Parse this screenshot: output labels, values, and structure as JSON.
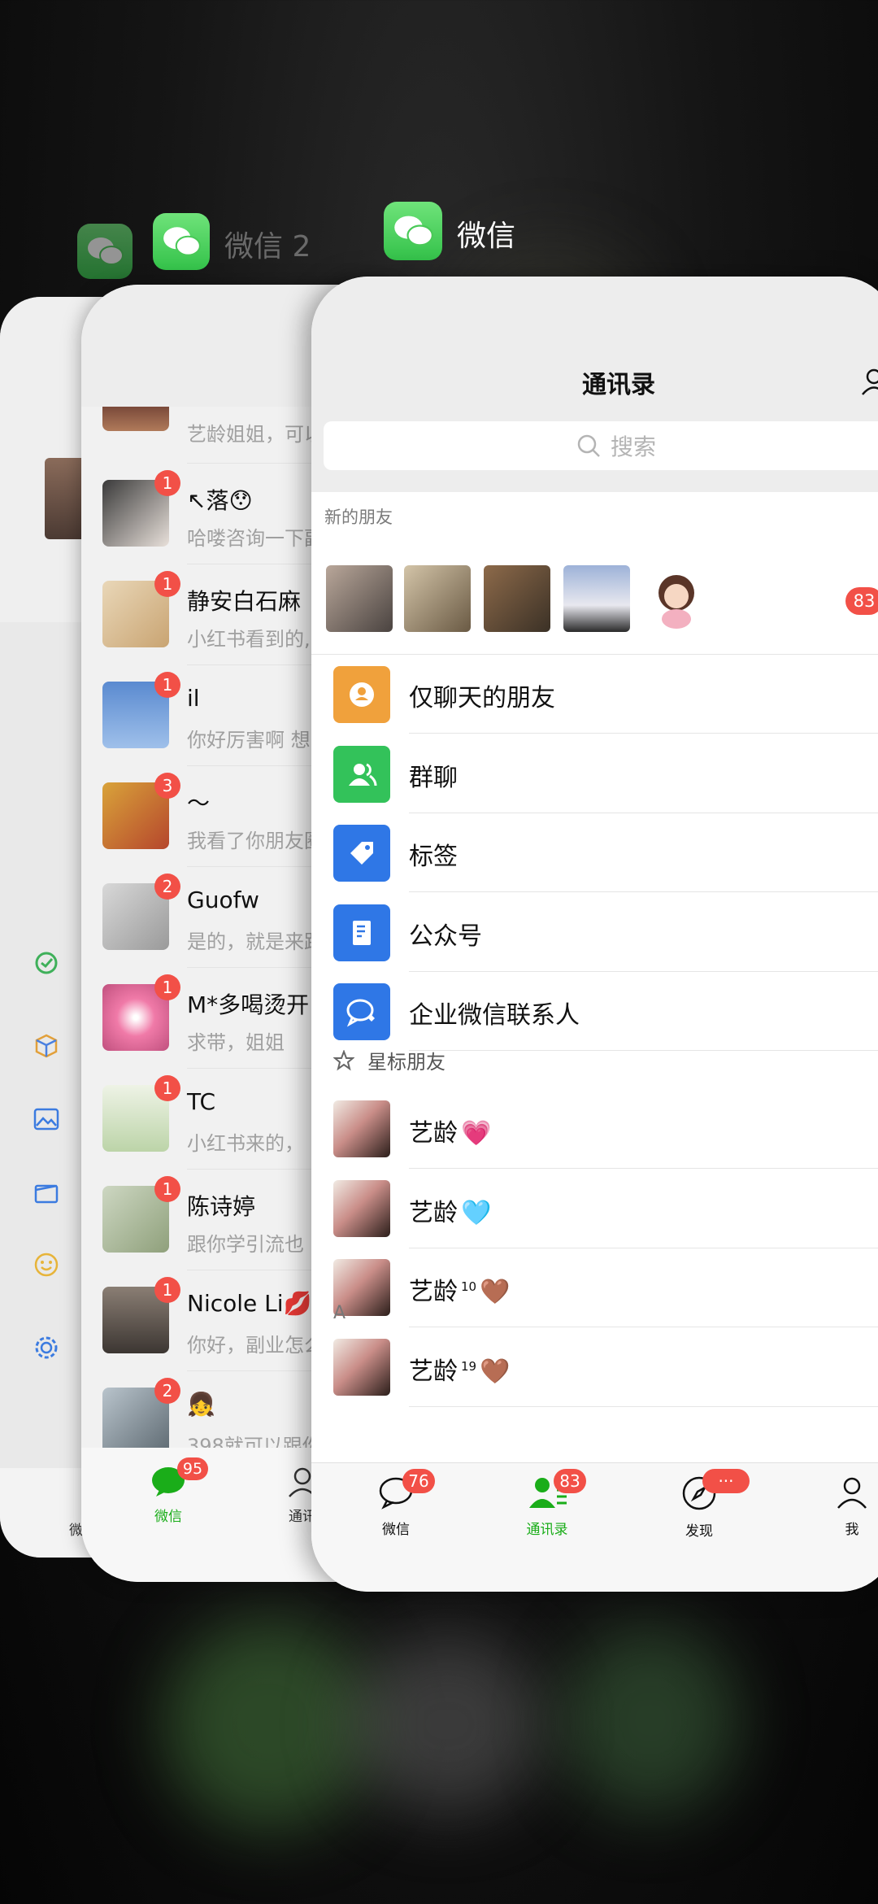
{
  "switcher": {
    "app_current": "微信",
    "app_second": "微信 2"
  },
  "front": {
    "title": "通讯录",
    "search_placeholder": "搜索",
    "new_friends_label": "新的朋友",
    "new_friends_count": "83",
    "menu": [
      {
        "label": "仅聊天的朋友",
        "color": "#f0a13c"
      },
      {
        "label": "群聊",
        "color": "#33c25a"
      },
      {
        "label": "标签",
        "color": "#2f77e6"
      },
      {
        "label": "公众号",
        "color": "#2f77e6"
      },
      {
        "label": "企业微信联系人",
        "color": "#2f77e6"
      }
    ],
    "starred_label": "星标朋友",
    "starred": [
      {
        "name": "艺龄",
        "emoji": "💗",
        "sup": ""
      },
      {
        "name": "艺龄",
        "emoji": "🩵",
        "sup": ""
      },
      {
        "name": "艺龄",
        "emoji": "🤎",
        "sup": "10"
      },
      {
        "name": "艺龄",
        "emoji": "🤎",
        "sup": "19"
      }
    ],
    "alpha": "A",
    "tabs": [
      {
        "label": "微信",
        "badge": "76"
      },
      {
        "label": "通讯录",
        "badge": "83"
      },
      {
        "label": "发现",
        "badge": "···"
      },
      {
        "label": "我",
        "badge": ""
      }
    ]
  },
  "mid": {
    "top_partial": "艺龄姐姐，可以",
    "chats": [
      {
        "name": "↖落😯",
        "msg": "哈喽咨询一下副",
        "badge": "1"
      },
      {
        "name": "静安白石麻",
        "msg": "小红书看到的,",
        "badge": "1"
      },
      {
        "name": "il",
        "msg": "你好厉害啊 想",
        "badge": "1"
      },
      {
        "name": "～",
        "msg": "我看了你朋友圈",
        "badge": "3"
      },
      {
        "name": "Guofw",
        "msg": "是的，就是来跟",
        "badge": "2"
      },
      {
        "name": "M*多喝烫开",
        "msg": "求带，姐姐",
        "badge": "1"
      },
      {
        "name": "TC",
        "msg": "小红书来的，",
        "badge": "1"
      },
      {
        "name": "陈诗婷",
        "msg": "跟你学引流也",
        "badge": "1"
      },
      {
        "name": "Nicole Li💋",
        "msg": "你好，副业怎么",
        "badge": "1"
      },
      {
        "name": "👧",
        "msg": "398就可以跟你",
        "badge": "2"
      }
    ],
    "tab_wechat": "微信",
    "tab_wechat_badge": "95",
    "tab_contacts_partial": "通讯",
    "back_tab_partial": "微"
  },
  "colors": {
    "wechat_green": "#1aad19",
    "badge_red": "#f25047"
  }
}
